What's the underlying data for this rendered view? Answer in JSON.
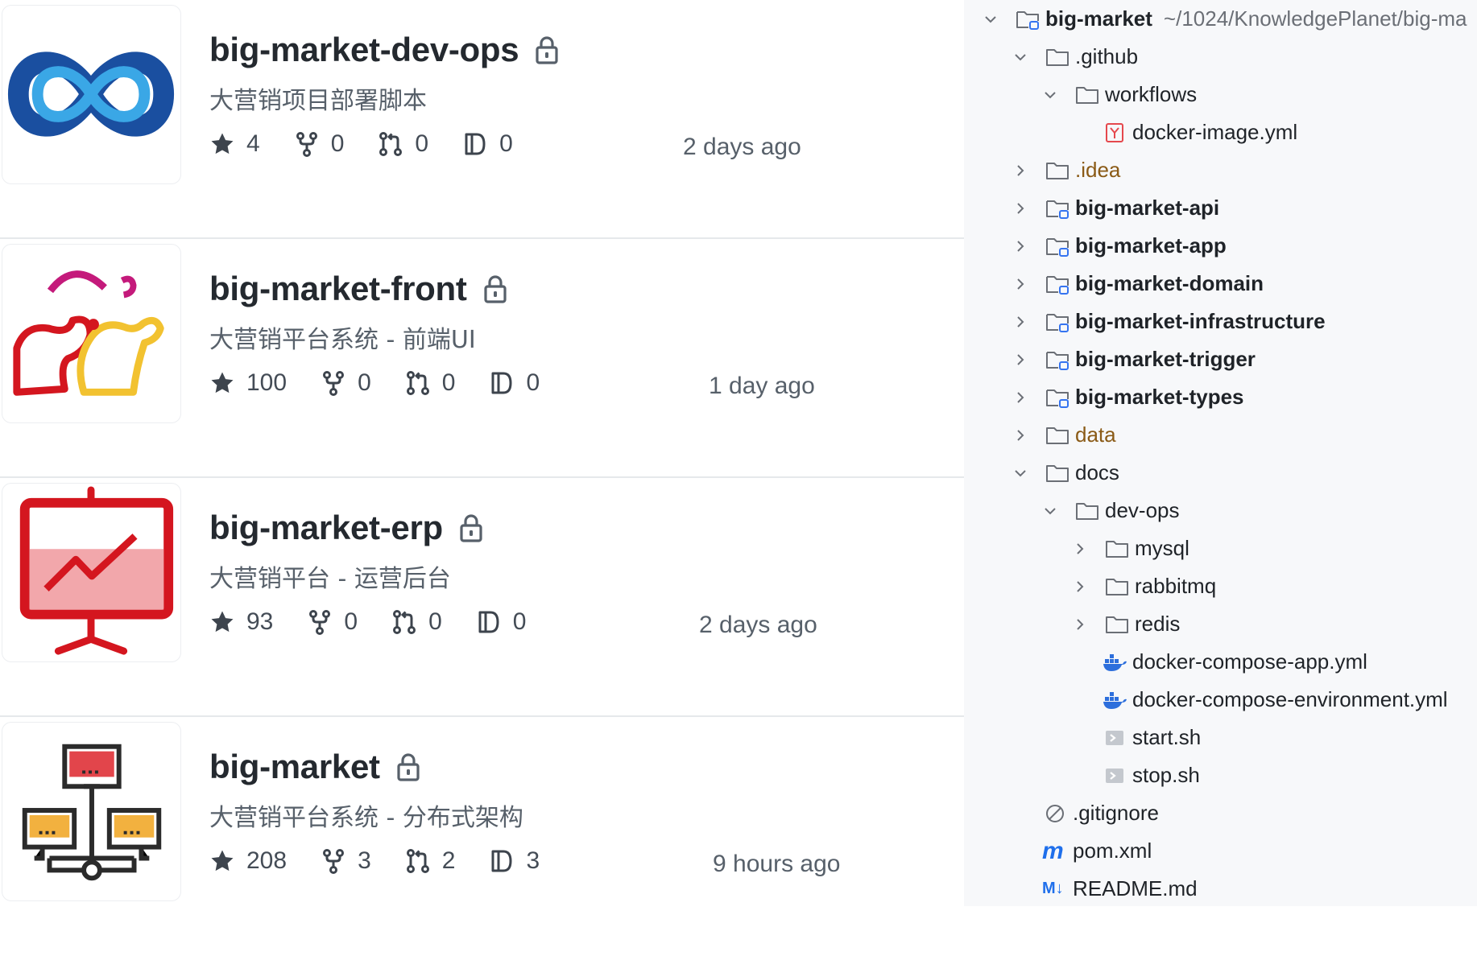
{
  "repositories": [
    {
      "name": "big-market-dev-ops",
      "description": "大营销项目部署脚本",
      "stars": "4",
      "forks": "0",
      "pull_requests": "0",
      "issues": "0",
      "updated": "2 days ago",
      "avatar_icon": "infinity-logo-icon"
    },
    {
      "name": "big-market-front",
      "description": "大营销平台系统 - 前端UI",
      "stars": "100",
      "forks": "0",
      "pull_requests": "0",
      "issues": "0",
      "updated": "1 day ago",
      "avatar_icon": "snails-logo-icon"
    },
    {
      "name": "big-market-erp",
      "description": "大营销平台 - 运营后台",
      "stars": "93",
      "forks": "0",
      "pull_requests": "0",
      "issues": "0",
      "updated": "2 days ago",
      "avatar_icon": "presentation-chart-icon"
    },
    {
      "name": "big-market",
      "description": "大营销平台系统 - 分布式架构",
      "stars": "208",
      "forks": "3",
      "pull_requests": "2",
      "issues": "3",
      "updated": "9 hours ago",
      "avatar_icon": "network-computers-icon"
    }
  ],
  "icons": {
    "lock": "lock-icon",
    "star": "star-icon",
    "fork": "fork-icon",
    "pull_request": "pull-request-icon",
    "issue": "issue-icon"
  },
  "tree": {
    "root": {
      "name": "big-market",
      "path": "~/1024/KnowledgePlanet/big-ma"
    },
    "items": [
      {
        "label": ".github"
      },
      {
        "label": "workflows"
      },
      {
        "label": "docker-image.yml"
      },
      {
        "label": ".idea"
      },
      {
        "label": "big-market-api"
      },
      {
        "label": "big-market-app"
      },
      {
        "label": "big-market-domain"
      },
      {
        "label": "big-market-infrastructure"
      },
      {
        "label": "big-market-trigger"
      },
      {
        "label": "big-market-types"
      },
      {
        "label": "data"
      },
      {
        "label": "docs"
      },
      {
        "label": "dev-ops"
      },
      {
        "label": "mysql"
      },
      {
        "label": "rabbitmq"
      },
      {
        "label": "redis"
      },
      {
        "label": "docker-compose-app.yml"
      },
      {
        "label": "docker-compose-environment.yml"
      },
      {
        "label": "start.sh"
      },
      {
        "label": "stop.sh"
      },
      {
        "label": ".gitignore"
      },
      {
        "label": "pom.xml",
        "icon_text": "m"
      },
      {
        "label": "README.md",
        "icon_text": "M↓"
      }
    ]
  },
  "colors": {
    "module_folder_badge": "#3574f0",
    "idea_folder_text": "#8a5a16",
    "yaml_icon": "#e5484d",
    "docker_icon": "#2d6fdc"
  }
}
